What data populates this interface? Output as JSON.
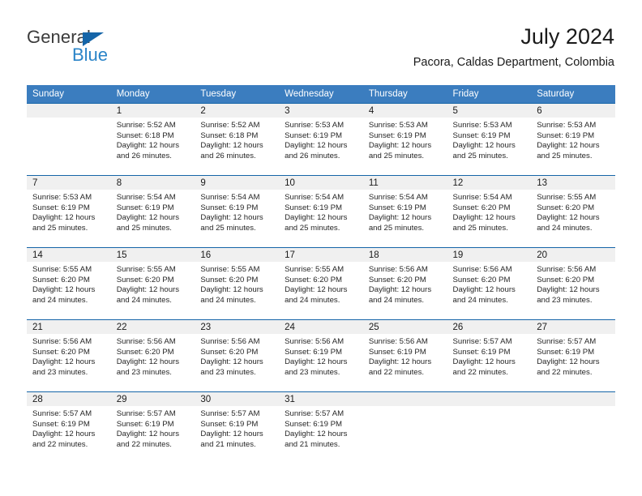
{
  "brand": {
    "word_one": "General",
    "word_two": "Blue",
    "triangle_icon": "triangle-icon",
    "accent_blue": "#2a84c8",
    "logo_dark": "#3b3b3b"
  },
  "header": {
    "title": "July 2024",
    "subtitle": "Pacora, Caldas Department, Colombia"
  },
  "theme": {
    "header_bar": "#3b7dbf",
    "row_rule": "#1565a8",
    "daynum_band": "#f0f0f0"
  },
  "weekdays": [
    "Sunday",
    "Monday",
    "Tuesday",
    "Wednesday",
    "Thursday",
    "Friday",
    "Saturday"
  ],
  "weeks": [
    [
      {
        "day": "",
        "sunrise": "",
        "sunset": "",
        "daylight_line1": "",
        "daylight_line2": ""
      },
      {
        "day": "1",
        "sunrise": "Sunrise: 5:52 AM",
        "sunset": "Sunset: 6:18 PM",
        "daylight_line1": "Daylight: 12 hours",
        "daylight_line2": "and 26 minutes."
      },
      {
        "day": "2",
        "sunrise": "Sunrise: 5:52 AM",
        "sunset": "Sunset: 6:18 PM",
        "daylight_line1": "Daylight: 12 hours",
        "daylight_line2": "and 26 minutes."
      },
      {
        "day": "3",
        "sunrise": "Sunrise: 5:53 AM",
        "sunset": "Sunset: 6:19 PM",
        "daylight_line1": "Daylight: 12 hours",
        "daylight_line2": "and 26 minutes."
      },
      {
        "day": "4",
        "sunrise": "Sunrise: 5:53 AM",
        "sunset": "Sunset: 6:19 PM",
        "daylight_line1": "Daylight: 12 hours",
        "daylight_line2": "and 25 minutes."
      },
      {
        "day": "5",
        "sunrise": "Sunrise: 5:53 AM",
        "sunset": "Sunset: 6:19 PM",
        "daylight_line1": "Daylight: 12 hours",
        "daylight_line2": "and 25 minutes."
      },
      {
        "day": "6",
        "sunrise": "Sunrise: 5:53 AM",
        "sunset": "Sunset: 6:19 PM",
        "daylight_line1": "Daylight: 12 hours",
        "daylight_line2": "and 25 minutes."
      }
    ],
    [
      {
        "day": "7",
        "sunrise": "Sunrise: 5:53 AM",
        "sunset": "Sunset: 6:19 PM",
        "daylight_line1": "Daylight: 12 hours",
        "daylight_line2": "and 25 minutes."
      },
      {
        "day": "8",
        "sunrise": "Sunrise: 5:54 AM",
        "sunset": "Sunset: 6:19 PM",
        "daylight_line1": "Daylight: 12 hours",
        "daylight_line2": "and 25 minutes."
      },
      {
        "day": "9",
        "sunrise": "Sunrise: 5:54 AM",
        "sunset": "Sunset: 6:19 PM",
        "daylight_line1": "Daylight: 12 hours",
        "daylight_line2": "and 25 minutes."
      },
      {
        "day": "10",
        "sunrise": "Sunrise: 5:54 AM",
        "sunset": "Sunset: 6:19 PM",
        "daylight_line1": "Daylight: 12 hours",
        "daylight_line2": "and 25 minutes."
      },
      {
        "day": "11",
        "sunrise": "Sunrise: 5:54 AM",
        "sunset": "Sunset: 6:19 PM",
        "daylight_line1": "Daylight: 12 hours",
        "daylight_line2": "and 25 minutes."
      },
      {
        "day": "12",
        "sunrise": "Sunrise: 5:54 AM",
        "sunset": "Sunset: 6:20 PM",
        "daylight_line1": "Daylight: 12 hours",
        "daylight_line2": "and 25 minutes."
      },
      {
        "day": "13",
        "sunrise": "Sunrise: 5:55 AM",
        "sunset": "Sunset: 6:20 PM",
        "daylight_line1": "Daylight: 12 hours",
        "daylight_line2": "and 24 minutes."
      }
    ],
    [
      {
        "day": "14",
        "sunrise": "Sunrise: 5:55 AM",
        "sunset": "Sunset: 6:20 PM",
        "daylight_line1": "Daylight: 12 hours",
        "daylight_line2": "and 24 minutes."
      },
      {
        "day": "15",
        "sunrise": "Sunrise: 5:55 AM",
        "sunset": "Sunset: 6:20 PM",
        "daylight_line1": "Daylight: 12 hours",
        "daylight_line2": "and 24 minutes."
      },
      {
        "day": "16",
        "sunrise": "Sunrise: 5:55 AM",
        "sunset": "Sunset: 6:20 PM",
        "daylight_line1": "Daylight: 12 hours",
        "daylight_line2": "and 24 minutes."
      },
      {
        "day": "17",
        "sunrise": "Sunrise: 5:55 AM",
        "sunset": "Sunset: 6:20 PM",
        "daylight_line1": "Daylight: 12 hours",
        "daylight_line2": "and 24 minutes."
      },
      {
        "day": "18",
        "sunrise": "Sunrise: 5:56 AM",
        "sunset": "Sunset: 6:20 PM",
        "daylight_line1": "Daylight: 12 hours",
        "daylight_line2": "and 24 minutes."
      },
      {
        "day": "19",
        "sunrise": "Sunrise: 5:56 AM",
        "sunset": "Sunset: 6:20 PM",
        "daylight_line1": "Daylight: 12 hours",
        "daylight_line2": "and 24 minutes."
      },
      {
        "day": "20",
        "sunrise": "Sunrise: 5:56 AM",
        "sunset": "Sunset: 6:20 PM",
        "daylight_line1": "Daylight: 12 hours",
        "daylight_line2": "and 23 minutes."
      }
    ],
    [
      {
        "day": "21",
        "sunrise": "Sunrise: 5:56 AM",
        "sunset": "Sunset: 6:20 PM",
        "daylight_line1": "Daylight: 12 hours",
        "daylight_line2": "and 23 minutes."
      },
      {
        "day": "22",
        "sunrise": "Sunrise: 5:56 AM",
        "sunset": "Sunset: 6:20 PM",
        "daylight_line1": "Daylight: 12 hours",
        "daylight_line2": "and 23 minutes."
      },
      {
        "day": "23",
        "sunrise": "Sunrise: 5:56 AM",
        "sunset": "Sunset: 6:20 PM",
        "daylight_line1": "Daylight: 12 hours",
        "daylight_line2": "and 23 minutes."
      },
      {
        "day": "24",
        "sunrise": "Sunrise: 5:56 AM",
        "sunset": "Sunset: 6:19 PM",
        "daylight_line1": "Daylight: 12 hours",
        "daylight_line2": "and 23 minutes."
      },
      {
        "day": "25",
        "sunrise": "Sunrise: 5:56 AM",
        "sunset": "Sunset: 6:19 PM",
        "daylight_line1": "Daylight: 12 hours",
        "daylight_line2": "and 22 minutes."
      },
      {
        "day": "26",
        "sunrise": "Sunrise: 5:57 AM",
        "sunset": "Sunset: 6:19 PM",
        "daylight_line1": "Daylight: 12 hours",
        "daylight_line2": "and 22 minutes."
      },
      {
        "day": "27",
        "sunrise": "Sunrise: 5:57 AM",
        "sunset": "Sunset: 6:19 PM",
        "daylight_line1": "Daylight: 12 hours",
        "daylight_line2": "and 22 minutes."
      }
    ],
    [
      {
        "day": "28",
        "sunrise": "Sunrise: 5:57 AM",
        "sunset": "Sunset: 6:19 PM",
        "daylight_line1": "Daylight: 12 hours",
        "daylight_line2": "and 22 minutes."
      },
      {
        "day": "29",
        "sunrise": "Sunrise: 5:57 AM",
        "sunset": "Sunset: 6:19 PM",
        "daylight_line1": "Daylight: 12 hours",
        "daylight_line2": "and 22 minutes."
      },
      {
        "day": "30",
        "sunrise": "Sunrise: 5:57 AM",
        "sunset": "Sunset: 6:19 PM",
        "daylight_line1": "Daylight: 12 hours",
        "daylight_line2": "and 21 minutes."
      },
      {
        "day": "31",
        "sunrise": "Sunrise: 5:57 AM",
        "sunset": "Sunset: 6:19 PM",
        "daylight_line1": "Daylight: 12 hours",
        "daylight_line2": "and 21 minutes."
      },
      {
        "day": "",
        "sunrise": "",
        "sunset": "",
        "daylight_line1": "",
        "daylight_line2": ""
      },
      {
        "day": "",
        "sunrise": "",
        "sunset": "",
        "daylight_line1": "",
        "daylight_line2": ""
      },
      {
        "day": "",
        "sunrise": "",
        "sunset": "",
        "daylight_line1": "",
        "daylight_line2": ""
      }
    ]
  ]
}
